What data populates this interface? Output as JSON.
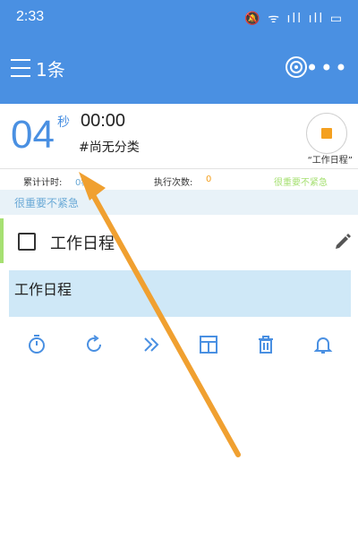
{
  "status_bar": {
    "time": "2:33",
    "icons_text": "🔕 ᯤ ıll ıll ▭"
  },
  "app_bar": {
    "count_label": "1条"
  },
  "timer": {
    "seconds": "04",
    "seconds_unit": "秒",
    "hours_minutes": "00:00",
    "category": "#尚无分类",
    "stop_caption": "“工作日程”"
  },
  "stats": {
    "cumulative_label": "累计计时:",
    "cumulative_value": "0秒",
    "executions_label": "执行次数:",
    "executions_value": "0",
    "priority_tag": "很重要不紧急"
  },
  "category_band": {
    "label": "很重要不紧急"
  },
  "task": {
    "title": "工作日程"
  },
  "note": {
    "text": "工作日程"
  },
  "toolbar": {
    "icons": [
      "stopwatch-icon",
      "refresh-icon",
      "double-chevron-icon",
      "layout-icon",
      "trash-icon",
      "bell-icon"
    ]
  },
  "colors": {
    "primary": "#4a90e2",
    "stop": "#f4a020",
    "accent_green": "#a6e072",
    "note_bg": "#cfe8f7",
    "arrow": "#f0a030"
  }
}
